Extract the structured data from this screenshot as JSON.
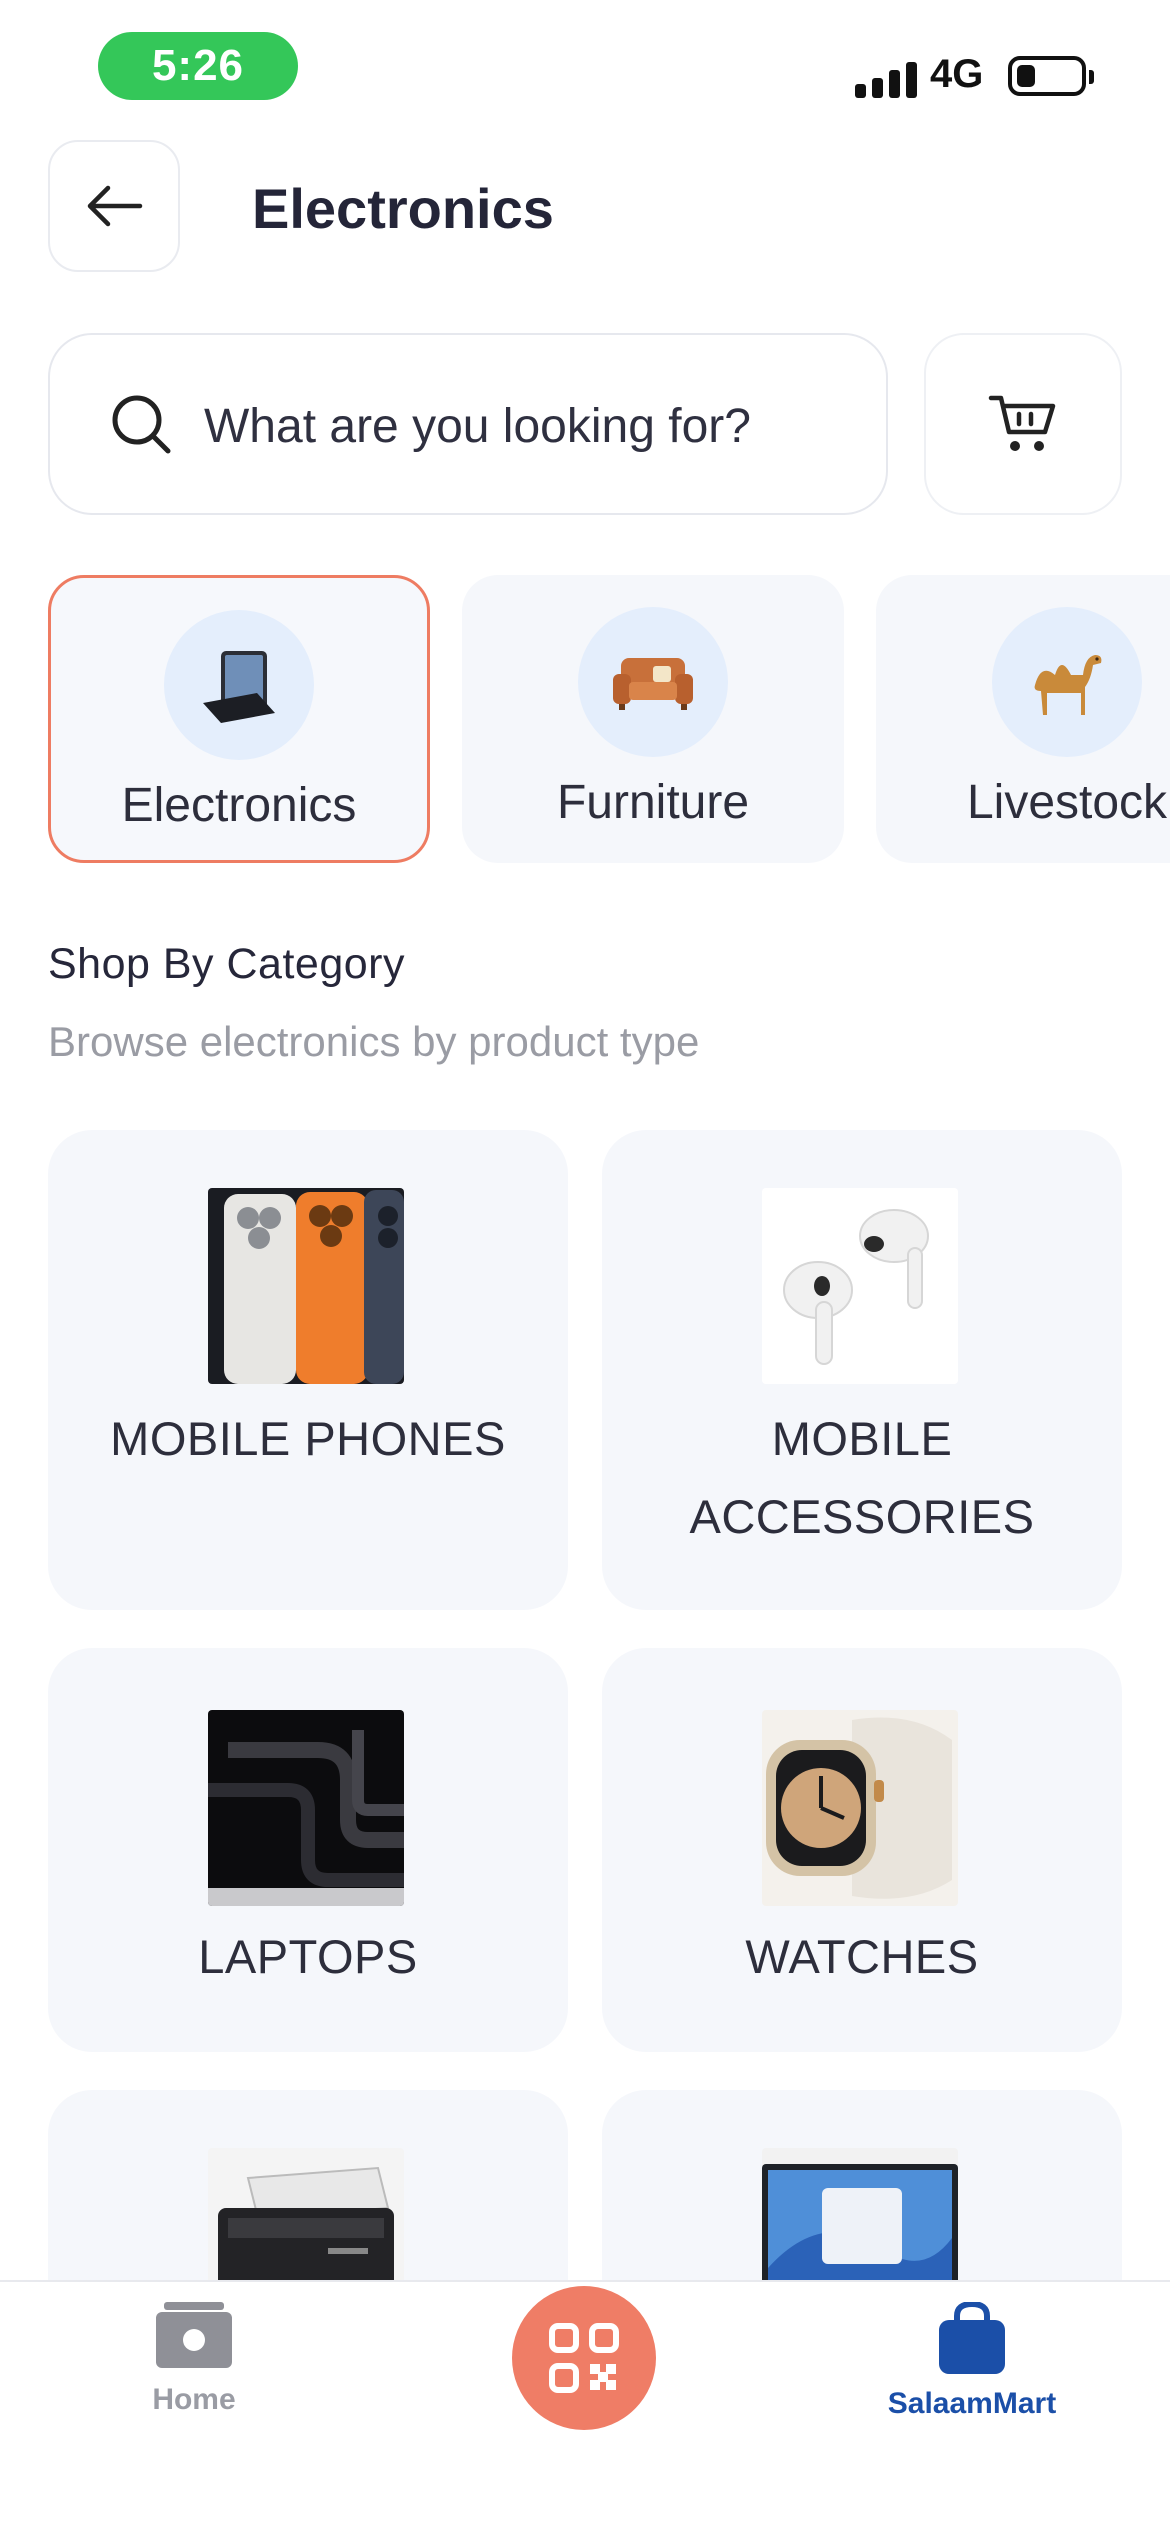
{
  "status_bar": {
    "time": "5:26",
    "network": "4G"
  },
  "header": {
    "title": "Electronics"
  },
  "search": {
    "placeholder": "What are you looking for?"
  },
  "top_categories": [
    {
      "label": "Electronics",
      "icon": "tablet-keyboard-icon",
      "active": true
    },
    {
      "label": "Furniture",
      "icon": "sofa-icon",
      "active": false
    },
    {
      "label": "Livestock",
      "icon": "camel-icon",
      "active": false
    }
  ],
  "section": {
    "title": "Shop By Category",
    "subtitle": "Browse electronics by product type"
  },
  "product_categories": [
    {
      "label": "MOBILE PHONES",
      "image": "iphone-image"
    },
    {
      "label": "MOBILE ACCESSORIES",
      "image": "earbuds-image"
    },
    {
      "label": "LAPTOPS",
      "image": "macbook-image"
    },
    {
      "label": "WATCHES",
      "image": "smartwatch-image"
    },
    {
      "label": "",
      "image": "printer-image"
    },
    {
      "label": "",
      "image": "desktop-monitor-image"
    }
  ],
  "bottom_nav": {
    "home_label": "Home",
    "mart_label": "SalaamMart",
    "active": "SalaamMart"
  },
  "colors": {
    "accent": "#ef7d66",
    "status_green": "#34c759",
    "nav_active": "#1b4fa8",
    "card_bg": "#f5f7fb"
  }
}
